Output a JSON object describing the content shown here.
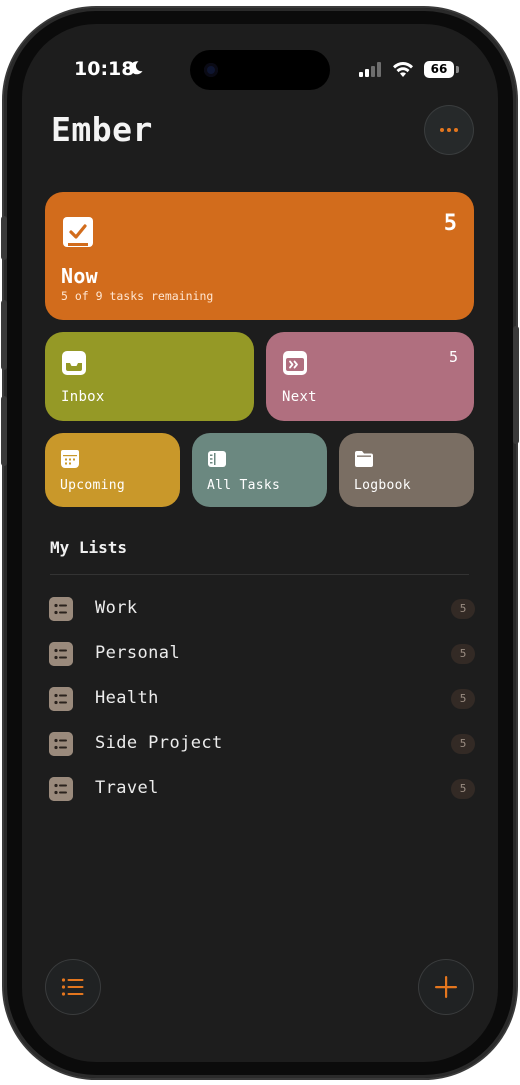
{
  "status_bar": {
    "time": "10:18",
    "battery": "66"
  },
  "header": {
    "title": "Ember",
    "more_icon": "ellipsis-icon"
  },
  "cards": {
    "now": {
      "label": "Now",
      "subtitle": "5 of 9 tasks remaining",
      "count": "5",
      "icon": "checkbox-icon",
      "color": "#d26c1c"
    },
    "inbox": {
      "label": "Inbox",
      "icon": "inbox-icon",
      "color": "#959926"
    },
    "next": {
      "label": "Next",
      "count": "5",
      "icon": "next-icon",
      "color": "#b06f7f"
    },
    "upcoming": {
      "label": "Upcoming",
      "icon": "calendar-icon",
      "color": "#c9982a"
    },
    "all_tasks": {
      "label": "All Tasks",
      "icon": "all-tasks-icon",
      "color": "#6b8880"
    },
    "logbook": {
      "label": "Logbook",
      "icon": "folder-icon",
      "color": "#7a6e63"
    }
  },
  "lists": {
    "title": "My Lists",
    "items": [
      {
        "label": "Work",
        "count": "5"
      },
      {
        "label": "Personal",
        "count": "5"
      },
      {
        "label": "Health",
        "count": "5"
      },
      {
        "label": "Side Project",
        "count": "5"
      },
      {
        "label": "Travel",
        "count": "5"
      }
    ]
  },
  "bottom_bar": {
    "left_icon": "list-icon",
    "right_icon": "plus-icon"
  },
  "colors": {
    "accent": "#e4761e",
    "background": "#1d1d1d"
  }
}
